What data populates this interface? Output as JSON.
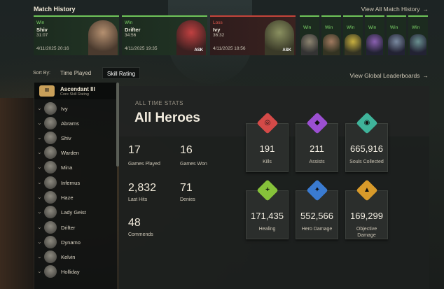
{
  "match_history": {
    "title": "Match History",
    "view_all": "View All Match History",
    "arrow": "→",
    "matches": [
      {
        "result": "Win",
        "hero": "Shiv",
        "duration": "31:07",
        "date": "4/11/2025 20:16",
        "tag": ""
      },
      {
        "result": "Win",
        "hero": "Drifter",
        "duration": "34:56",
        "date": "4/11/2025 19:35",
        "tag": "ASK"
      },
      {
        "result": "Loss",
        "hero": "Ivy",
        "duration": "36:32",
        "date": "4/11/2025 18:56",
        "tag": "ASK"
      }
    ],
    "small_matches": [
      "Win",
      "Win",
      "Win",
      "Win",
      "Win",
      "Win"
    ]
  },
  "sort": {
    "label": "Sort By:",
    "options": [
      "Time Played",
      "Skill Rating"
    ],
    "active": "Skill Rating"
  },
  "leaderboards": "View Global Leaderboards",
  "rank": {
    "badge": "III",
    "name": "Ascendant III",
    "sub": "Core Skill Rating"
  },
  "heroes": [
    "Ivy",
    "Abrams",
    "Shiv",
    "Warden",
    "Mina",
    "Infernus",
    "Haze",
    "Lady Geist",
    "Drifter",
    "Dynamo",
    "Kelvin",
    "Holliday"
  ],
  "stats": {
    "section": "ALL TIME STATS",
    "title": "All Heroes",
    "games_played": {
      "value": "17",
      "label": "Games Played"
    },
    "games_won": {
      "value": "16",
      "label": "Games Won"
    },
    "last_hits": {
      "value": "2,832",
      "label": "Last Hits"
    },
    "denies": {
      "value": "71",
      "label": "Denies"
    },
    "commends": {
      "value": "48",
      "label": "Commends"
    }
  },
  "tiles": [
    {
      "value": "191",
      "label": "Kills",
      "color": "#d44a48",
      "icon": "crosshair-icon",
      "glyph": "◎"
    },
    {
      "value": "211",
      "label": "Assists",
      "color": "#9b4fd1",
      "icon": "handshake-icon",
      "glyph": "◆"
    },
    {
      "value": "665,916",
      "label": "Souls Collected",
      "color": "#3fb39a",
      "icon": "soul-icon",
      "glyph": "◉"
    },
    {
      "value": "171,435",
      "label": "Healing",
      "color": "#86c23a",
      "icon": "plus-icon",
      "glyph": "+"
    },
    {
      "value": "552,566",
      "label": "Hero Damage",
      "color": "#3a7bd1",
      "icon": "bolt-icon",
      "glyph": "✦"
    },
    {
      "value": "169,299",
      "label": "Objective Damage",
      "color": "#d89a2a",
      "icon": "tower-icon",
      "glyph": "▲"
    }
  ]
}
